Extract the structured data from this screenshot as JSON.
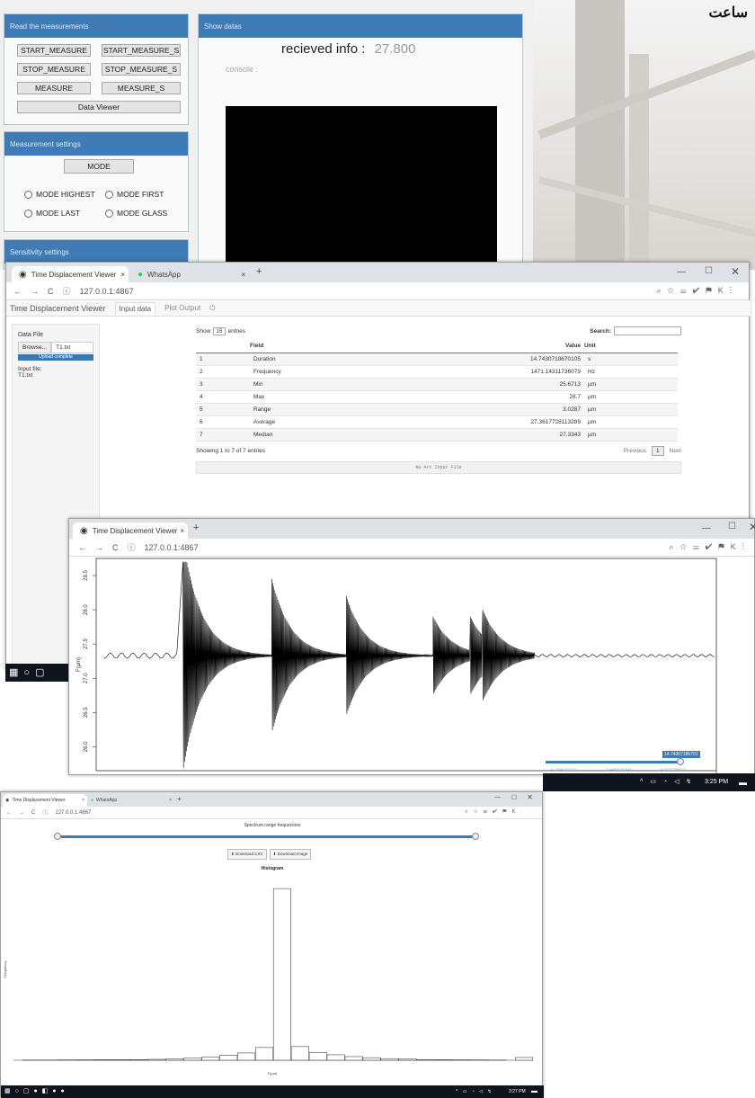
{
  "overlay_caption": "ساعت",
  "app": {
    "read_panel": {
      "title": "Read the measurements",
      "buttons": [
        "START_MEASURE",
        "START_MEASURE_S",
        "STOP_MEASURE",
        "STOP_MEASURE_S",
        "MEASURE",
        "MEASURE_S"
      ],
      "viewer": "Data Viewer"
    },
    "settings_panel": {
      "title": "Measurement settings",
      "mode_button": "MODE",
      "radios": [
        "MODE HIGHEST",
        "MODE FIRST",
        "MODE LAST",
        "MODE GLASS"
      ]
    },
    "sensitivity_panel": {
      "title": "Sensitivity settings"
    },
    "show_panel": {
      "title": "Show datas",
      "info_label": "recieved info :",
      "info_value": "27.800",
      "console_label": "console :"
    }
  },
  "win1": {
    "tabs": [
      {
        "title": "Time Displacement Viewer"
      },
      {
        "title": "WhatsApp"
      }
    ],
    "url": "127.0.0.1:4867",
    "nav": {
      "brand": "Time Displacement Viewer",
      "items": [
        "Input data",
        "Plot Output"
      ]
    },
    "sidebar": {
      "title": "Data File",
      "browse": "Browse...",
      "file": "T1.txt",
      "upload": "Upload complete",
      "input_label": "Input file:",
      "input_value": "T1.txt"
    },
    "table": {
      "show_prefix": "Show",
      "show_value": "15",
      "show_suffix": "entries",
      "search_label": "Search:",
      "columns": [
        "",
        "Field",
        "Value",
        "Unit"
      ],
      "rows": [
        [
          "1",
          "Duration",
          "14.7430718670105",
          "s"
        ],
        [
          "2",
          "Frequency",
          "1471.14311736079",
          "Hz"
        ],
        [
          "3",
          "Min",
          "25.6713",
          "µm"
        ],
        [
          "4",
          "Max",
          "28.7",
          "µm"
        ],
        [
          "5",
          "Range",
          "3.0287",
          "µm"
        ],
        [
          "6",
          "Average",
          "27.3617728113289",
          "µm"
        ],
        [
          "7",
          "Median",
          "27.3343",
          "µm"
        ]
      ],
      "info": "Showing 1 to 7 of 7 entries",
      "prev": "Previous",
      "page": "1",
      "next": "Next",
      "footer": "No Art Input File"
    }
  },
  "win2": {
    "tabs": [
      {
        "title": "Time Displacement Viewer"
      }
    ],
    "url": "127.0.0.1:4867",
    "y_label": "F(µm)",
    "y_ticks": [
      "28.5",
      "28.0",
      "27.5",
      "27.0",
      "26.5",
      "26.0"
    ],
    "x_tick_last": "15",
    "slider_value": "14.74307186701",
    "slider_ticks": [
      "4.73840351630",
      "9.44658251845",
      "14.16272396877"
    ],
    "taskbar_time": "3:25 PM"
  },
  "win3": {
    "tabs": [
      {
        "title": "Time Displacement Viewer"
      },
      {
        "title": "WhatsApp"
      }
    ],
    "url": "127.0.0.1:4867",
    "slider_title": "Spectrum range frequencies",
    "buttons": [
      "Download CSV",
      "Download Image"
    ],
    "taskbar_time": "3:27 PM"
  },
  "chart_data": [
    {
      "type": "line",
      "title": "",
      "xlabel": "",
      "ylabel": "F(µm)",
      "ylim": [
        25.65,
        28.75
      ],
      "xlim": [
        0,
        15
      ],
      "series": [
        {
          "values": [
            [
              0.2,
              27.3
            ],
            [
              1.8,
              27.35
            ],
            [
              2.0,
              27.33
            ],
            [
              2.1,
              25.67
            ],
            [
              2.15,
              28.7
            ],
            [
              4.2,
              27.3
            ],
            [
              4.25,
              28.45
            ],
            [
              6.0,
              27.33
            ],
            [
              6.05,
              28.2
            ],
            [
              7.6,
              27.35
            ],
            [
              8.1,
              27.35
            ],
            [
              8.15,
              27.9
            ],
            [
              9.0,
              27.35
            ],
            [
              9.05,
              27.9
            ],
            [
              9.3,
              27.35
            ],
            [
              9.35,
              28.0
            ],
            [
              10.3,
              27.33
            ],
            [
              10.5,
              27.33
            ],
            [
              15.0,
              27.33
            ]
          ]
        }
      ]
    },
    {
      "type": "bar",
      "title": "Histogram",
      "xlabel": "F(µm)",
      "ylabel": "Frequency",
      "series": [
        {
          "name": "",
          "values": [
            [
              25.9,
              2
            ],
            [
              26.0,
              2
            ],
            [
              26.1,
              3
            ],
            [
              26.2,
              4
            ],
            [
              26.3,
              5
            ],
            [
              26.4,
              6
            ],
            [
              26.5,
              7
            ],
            [
              26.6,
              10
            ],
            [
              26.7,
              15
            ],
            [
              26.8,
              22
            ],
            [
              26.9,
              35
            ],
            [
              27.0,
              55
            ],
            [
              27.1,
              80
            ],
            [
              27.2,
              140
            ],
            [
              27.3,
              1890
            ],
            [
              27.4,
              150
            ],
            [
              27.5,
              85
            ],
            [
              27.6,
              60
            ],
            [
              27.7,
              40
            ],
            [
              27.8,
              28
            ],
            [
              27.9,
              18
            ],
            [
              28.0,
              12
            ],
            [
              28.1,
              8
            ],
            [
              28.2,
              5
            ],
            [
              28.3,
              4
            ],
            [
              28.4,
              3
            ],
            [
              28.5,
              2
            ],
            [
              28.65,
              30
            ]
          ]
        }
      ]
    }
  ]
}
